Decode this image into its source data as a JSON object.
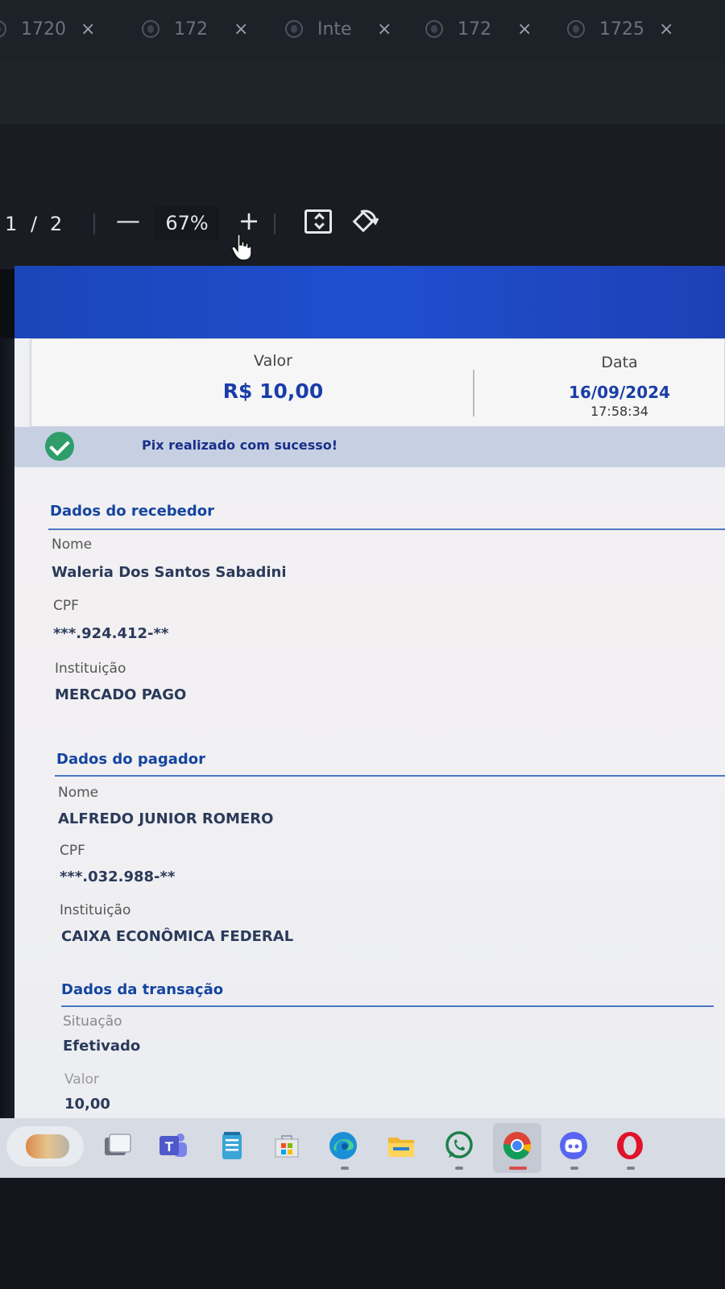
{
  "tabs": [
    {
      "title": "1720",
      "close": "×"
    },
    {
      "title": "172",
      "close": "×"
    },
    {
      "title": "Inte",
      "close": "×"
    },
    {
      "title": "172",
      "close": "×"
    },
    {
      "title": "1725",
      "close": "×"
    }
  ],
  "pdf_toolbar": {
    "page_current": "1",
    "page_separator": "/",
    "page_total": "2",
    "zoom_out": "—",
    "zoom_level": "67%",
    "zoom_in": "+"
  },
  "receipt": {
    "valor_label": "Valor",
    "valor_value": "R$ 10,00",
    "data_label": "Data",
    "data_value": "16/09/2024",
    "time_value": "17:58:34",
    "success_message": "Pix realizado com sucesso!"
  },
  "recebedor": {
    "title": "Dados do recebedor",
    "nome_label": "Nome",
    "nome_value": "Waleria Dos Santos Sabadini",
    "cpf_label": "CPF",
    "cpf_value": "***.924.412-**",
    "instituicao_label": "Instituição",
    "instituicao_value": "MERCADO PAGO"
  },
  "pagador": {
    "title": "Dados do pagador",
    "nome_label": "Nome",
    "nome_value": "ALFREDO JUNIOR ROMERO",
    "cpf_label": "CPF",
    "cpf_value": "***.032.988-**",
    "instituicao_label": "Instituição",
    "instituicao_value": "CAIXA ECONÔMICA FEDERAL"
  },
  "transacao": {
    "title": "Dados da transação",
    "situacao_label": "Situação",
    "situacao_value": "Efetivado",
    "valor_label": "Valor",
    "valor_value": "10,00"
  },
  "taskbar": {
    "icons": [
      "weather-icon",
      "task-view-icon",
      "teams-icon",
      "notepad-icon",
      "store-icon",
      "edge-icon",
      "file-explorer-icon",
      "whatsapp-icon",
      "chrome-icon",
      "discord-icon",
      "opera-icon"
    ]
  },
  "colors": {
    "brand_blue": "#1f4fcf",
    "accent_text": "#1545a0",
    "success_green": "#2e9d6a"
  }
}
